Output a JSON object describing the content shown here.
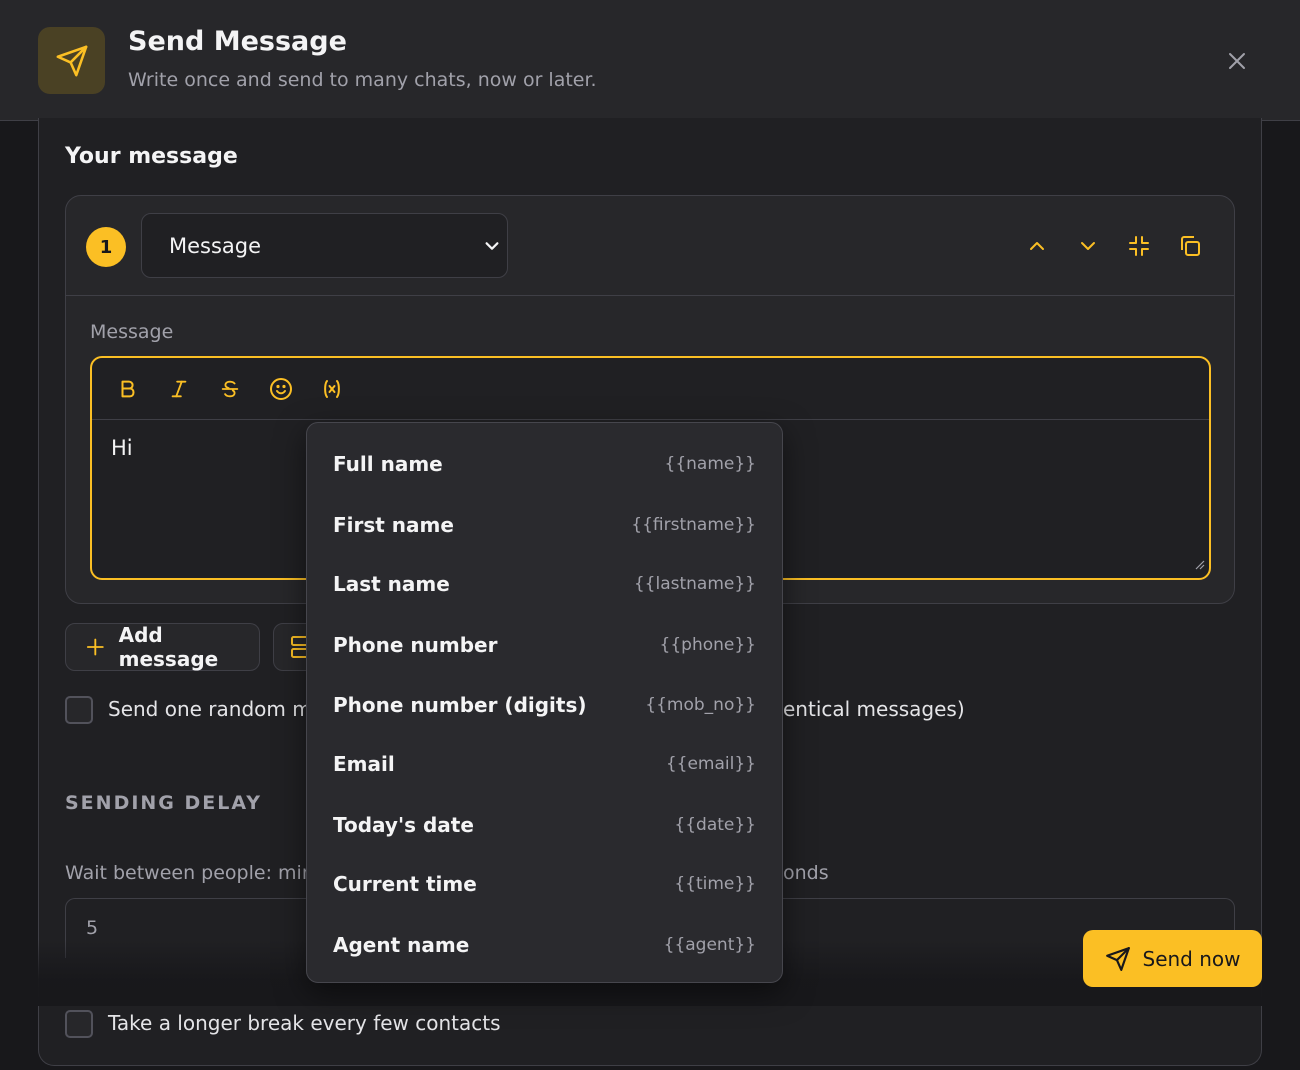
{
  "header": {
    "title": "Send Message",
    "subtitle": "Write once and send to many chats, now or later."
  },
  "section": {
    "title": "Your message"
  },
  "message_block": {
    "index": "1",
    "type_selected": "Message"
  },
  "editor": {
    "label": "Message",
    "content": "Hi"
  },
  "actions": {
    "add_message": "Add message"
  },
  "random_option": {
    "label_left": "Send one random m",
    "label_right": "entical messages)"
  },
  "delay": {
    "caption": "SENDING DELAY",
    "wait_label_left": "Wait between people: mini",
    "wait_label_right": "onds",
    "wait_value": "5"
  },
  "longer_break": {
    "label": "Take a longer break every few contacts"
  },
  "send": {
    "label": "Send now"
  },
  "variables": [
    {
      "label": "Full name",
      "token": "{{name}}"
    },
    {
      "label": "First name",
      "token": "{{firstname}}"
    },
    {
      "label": "Last name",
      "token": "{{lastname}}"
    },
    {
      "label": "Phone number",
      "token": "{{phone}}"
    },
    {
      "label": "Phone number (digits)",
      "token": "{{mob_no}}"
    },
    {
      "label": "Email",
      "token": "{{email}}"
    },
    {
      "label": "Today's date",
      "token": "{{date}}"
    },
    {
      "label": "Current time",
      "token": "{{time}}"
    },
    {
      "label": "Agent name",
      "token": "{{agent}}"
    }
  ],
  "colors": {
    "accent": "#fbbf24",
    "background": "#18181b",
    "surface": "#27272a",
    "border": "#3f3f46"
  }
}
